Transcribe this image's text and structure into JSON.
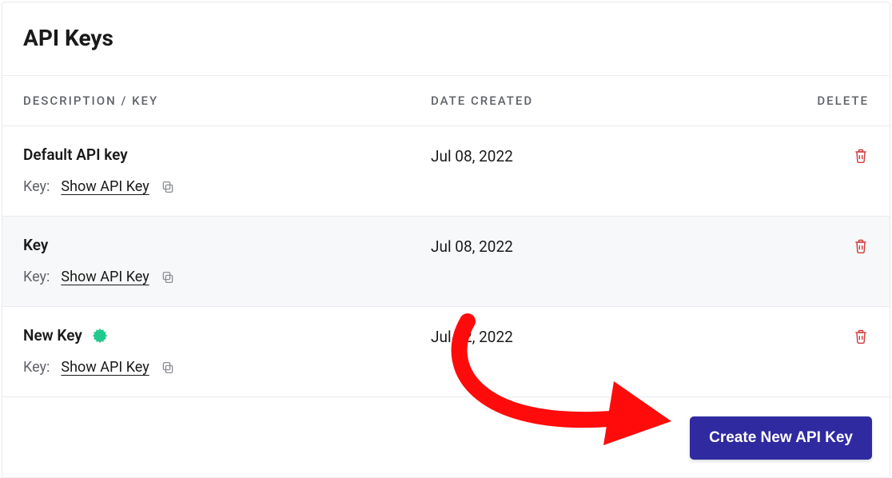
{
  "panel": {
    "title": "API Keys"
  },
  "table": {
    "headers": {
      "description": "DESCRIPTION / KEY",
      "date": "DATE CREATED",
      "delete": "DELETE"
    },
    "key_label": "Key:",
    "show_label": "Show API Key",
    "rows": [
      {
        "name": "Default API key",
        "date": "Jul 08, 2022",
        "new": false
      },
      {
        "name": "Key",
        "date": "Jul 08, 2022",
        "new": false
      },
      {
        "name": "New Key",
        "date": "Jul 22, 2022",
        "new": true
      }
    ]
  },
  "actions": {
    "create": "Create New API Key"
  },
  "colors": {
    "accent": "#2f2aa0",
    "danger": "#cf3a3a",
    "badge": "#22c98e"
  }
}
